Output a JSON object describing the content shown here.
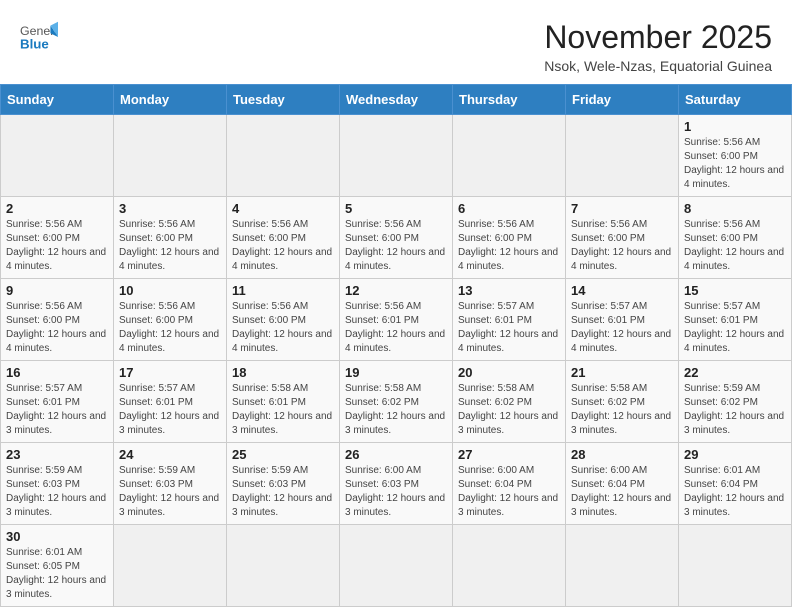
{
  "header": {
    "logo_general": "General",
    "logo_blue": "Blue",
    "month_title": "November 2025",
    "subtitle": "Nsok, Wele-Nzas, Equatorial Guinea"
  },
  "days_of_week": [
    "Sunday",
    "Monday",
    "Tuesday",
    "Wednesday",
    "Thursday",
    "Friday",
    "Saturday"
  ],
  "weeks": [
    [
      {
        "day": "",
        "info": ""
      },
      {
        "day": "",
        "info": ""
      },
      {
        "day": "",
        "info": ""
      },
      {
        "day": "",
        "info": ""
      },
      {
        "day": "",
        "info": ""
      },
      {
        "day": "",
        "info": ""
      },
      {
        "day": "1",
        "info": "Sunrise: 5:56 AM\nSunset: 6:00 PM\nDaylight: 12 hours and 4 minutes."
      }
    ],
    [
      {
        "day": "2",
        "info": "Sunrise: 5:56 AM\nSunset: 6:00 PM\nDaylight: 12 hours and 4 minutes."
      },
      {
        "day": "3",
        "info": "Sunrise: 5:56 AM\nSunset: 6:00 PM\nDaylight: 12 hours and 4 minutes."
      },
      {
        "day": "4",
        "info": "Sunrise: 5:56 AM\nSunset: 6:00 PM\nDaylight: 12 hours and 4 minutes."
      },
      {
        "day": "5",
        "info": "Sunrise: 5:56 AM\nSunset: 6:00 PM\nDaylight: 12 hours and 4 minutes."
      },
      {
        "day": "6",
        "info": "Sunrise: 5:56 AM\nSunset: 6:00 PM\nDaylight: 12 hours and 4 minutes."
      },
      {
        "day": "7",
        "info": "Sunrise: 5:56 AM\nSunset: 6:00 PM\nDaylight: 12 hours and 4 minutes."
      },
      {
        "day": "8",
        "info": "Sunrise: 5:56 AM\nSunset: 6:00 PM\nDaylight: 12 hours and 4 minutes."
      }
    ],
    [
      {
        "day": "9",
        "info": "Sunrise: 5:56 AM\nSunset: 6:00 PM\nDaylight: 12 hours and 4 minutes."
      },
      {
        "day": "10",
        "info": "Sunrise: 5:56 AM\nSunset: 6:00 PM\nDaylight: 12 hours and 4 minutes."
      },
      {
        "day": "11",
        "info": "Sunrise: 5:56 AM\nSunset: 6:00 PM\nDaylight: 12 hours and 4 minutes."
      },
      {
        "day": "12",
        "info": "Sunrise: 5:56 AM\nSunset: 6:01 PM\nDaylight: 12 hours and 4 minutes."
      },
      {
        "day": "13",
        "info": "Sunrise: 5:57 AM\nSunset: 6:01 PM\nDaylight: 12 hours and 4 minutes."
      },
      {
        "day": "14",
        "info": "Sunrise: 5:57 AM\nSunset: 6:01 PM\nDaylight: 12 hours and 4 minutes."
      },
      {
        "day": "15",
        "info": "Sunrise: 5:57 AM\nSunset: 6:01 PM\nDaylight: 12 hours and 4 minutes."
      }
    ],
    [
      {
        "day": "16",
        "info": "Sunrise: 5:57 AM\nSunset: 6:01 PM\nDaylight: 12 hours and 3 minutes."
      },
      {
        "day": "17",
        "info": "Sunrise: 5:57 AM\nSunset: 6:01 PM\nDaylight: 12 hours and 3 minutes."
      },
      {
        "day": "18",
        "info": "Sunrise: 5:58 AM\nSunset: 6:01 PM\nDaylight: 12 hours and 3 minutes."
      },
      {
        "day": "19",
        "info": "Sunrise: 5:58 AM\nSunset: 6:02 PM\nDaylight: 12 hours and 3 minutes."
      },
      {
        "day": "20",
        "info": "Sunrise: 5:58 AM\nSunset: 6:02 PM\nDaylight: 12 hours and 3 minutes."
      },
      {
        "day": "21",
        "info": "Sunrise: 5:58 AM\nSunset: 6:02 PM\nDaylight: 12 hours and 3 minutes."
      },
      {
        "day": "22",
        "info": "Sunrise: 5:59 AM\nSunset: 6:02 PM\nDaylight: 12 hours and 3 minutes."
      }
    ],
    [
      {
        "day": "23",
        "info": "Sunrise: 5:59 AM\nSunset: 6:03 PM\nDaylight: 12 hours and 3 minutes."
      },
      {
        "day": "24",
        "info": "Sunrise: 5:59 AM\nSunset: 6:03 PM\nDaylight: 12 hours and 3 minutes."
      },
      {
        "day": "25",
        "info": "Sunrise: 5:59 AM\nSunset: 6:03 PM\nDaylight: 12 hours and 3 minutes."
      },
      {
        "day": "26",
        "info": "Sunrise: 6:00 AM\nSunset: 6:03 PM\nDaylight: 12 hours and 3 minutes."
      },
      {
        "day": "27",
        "info": "Sunrise: 6:00 AM\nSunset: 6:04 PM\nDaylight: 12 hours and 3 minutes."
      },
      {
        "day": "28",
        "info": "Sunrise: 6:00 AM\nSunset: 6:04 PM\nDaylight: 12 hours and 3 minutes."
      },
      {
        "day": "29",
        "info": "Sunrise: 6:01 AM\nSunset: 6:04 PM\nDaylight: 12 hours and 3 minutes."
      }
    ],
    [
      {
        "day": "30",
        "info": "Sunrise: 6:01 AM\nSunset: 6:05 PM\nDaylight: 12 hours and 3 minutes."
      },
      {
        "day": "",
        "info": ""
      },
      {
        "day": "",
        "info": ""
      },
      {
        "day": "",
        "info": ""
      },
      {
        "day": "",
        "info": ""
      },
      {
        "day": "",
        "info": ""
      },
      {
        "day": "",
        "info": ""
      }
    ]
  ]
}
